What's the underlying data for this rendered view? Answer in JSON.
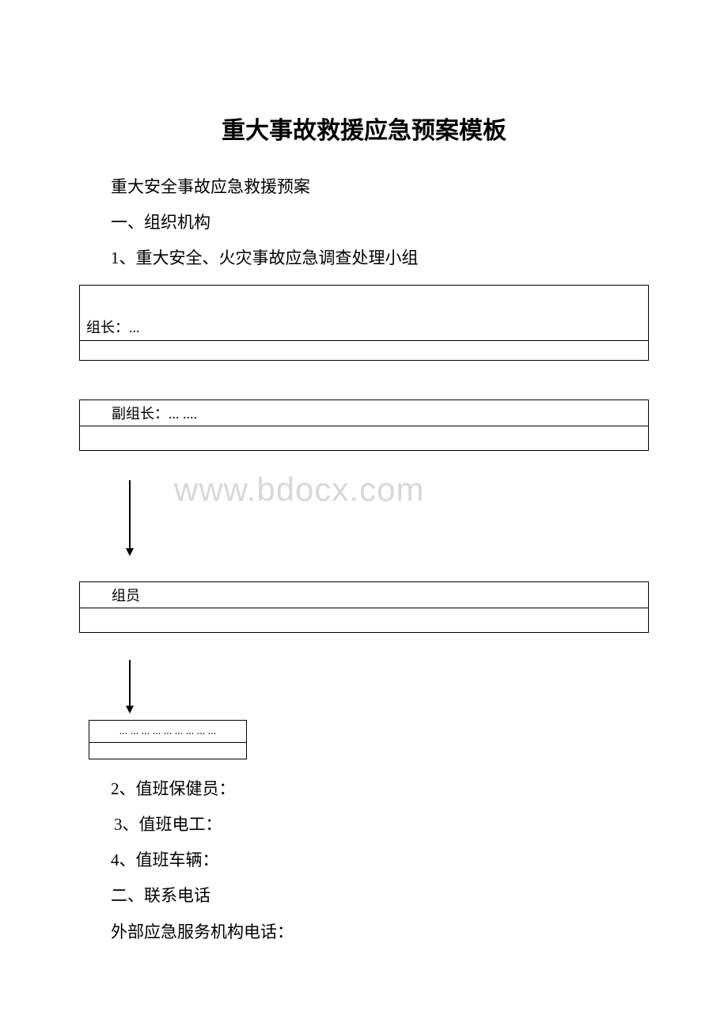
{
  "title": "重大事故救援应急预案模板",
  "lines": {
    "l1": "重大安全事故应急救援预案",
    "l2": "一、组织机构",
    "l3": "1、重大安全、火灾事故应急调查处理小组",
    "l4": "2、值班保健员：",
    "l5": "3、值班电工：",
    "l6": "4、值班车辆：",
    "l7": "二、联系电话",
    "l8": "外部应急服务机构电话："
  },
  "boxes": {
    "b1": "组长：...",
    "b2": "副组长：... ....",
    "b3": "组员",
    "b4": "... ... ... ... ... ... ... ... ..."
  },
  "watermark": "www.bdocx.com"
}
